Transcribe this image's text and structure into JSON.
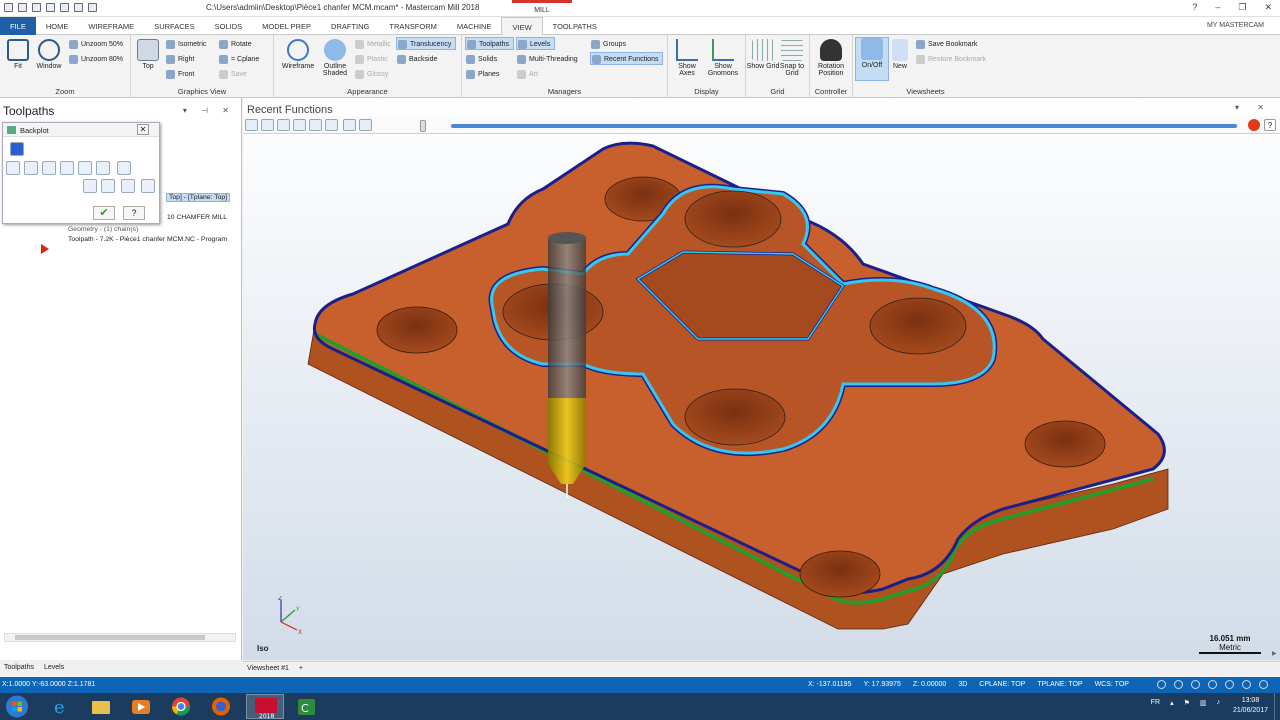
{
  "titlebar": {
    "path": "C:\\Users\\admiin\\Desktop\\Pièce1 chanfer MCM.mcam* - Mastercam Mill 2018",
    "context_tab": "MILL"
  },
  "tabs": [
    {
      "label": "FILE",
      "kind": "file"
    },
    {
      "label": "HOME",
      "kind": ""
    },
    {
      "label": "WIREFRAME",
      "kind": ""
    },
    {
      "label": "SURFACES",
      "kind": ""
    },
    {
      "label": "SOLIDS",
      "kind": ""
    },
    {
      "label": "MODEL PREP",
      "kind": ""
    },
    {
      "label": "DRAFTING",
      "kind": ""
    },
    {
      "label": "TRANSFORM",
      "kind": ""
    },
    {
      "label": "MACHINE",
      "kind": ""
    },
    {
      "label": "VIEW",
      "kind": "active"
    },
    {
      "label": "TOOLPATHS",
      "kind": "ctx"
    }
  ],
  "my_mastercam": "MY MASTERCAM",
  "ribbon": {
    "zoom": {
      "label": "Zoom",
      "fit": "Fit",
      "window": "Window",
      "unzoom50": "Unzoom 50%",
      "unzoom80": "Unzoom 80%"
    },
    "graphics_view": {
      "label": "Graphics View",
      "top": "Top",
      "isometric": "Isometric",
      "right": "Right",
      "front": "Front",
      "rotate": "Rotate",
      "cplane": "= Cplane",
      "save": "Save"
    },
    "appearance": {
      "label": "Appearance",
      "wireframe": "Wireframe",
      "outline_shaded": "Outline Shaded",
      "metallic": "Metallic",
      "plastic": "Plastic",
      "glossy": "Glossy",
      "translucency": "Translucency",
      "backside": "Backside"
    },
    "managers": {
      "label": "Managers",
      "toolpaths": "Toolpaths",
      "solids": "Solids",
      "planes": "Planes",
      "levels": "Levels",
      "multithreading": "Multi-Threading",
      "art": "Art",
      "groups": "Groups",
      "recent": "Recent Functions"
    },
    "display": {
      "label": "Display",
      "show_axes": "Show Axes",
      "show_gnomons": "Show Gnomons"
    },
    "grid": {
      "label": "Grid",
      "show_grid": "Show Grid",
      "snap_grid": "Snap to Grid"
    },
    "controller": {
      "label": "Controller",
      "rotation": "Rotation Position"
    },
    "viewsheets": {
      "label": "Viewsheets",
      "onoff": "On/Off",
      "new": "New",
      "save_bookmark": "Save Bookmark",
      "restore_bookmark": "Restore Bookmark"
    }
  },
  "left_panel": {
    "title": "Toolpaths",
    "backplot": {
      "title": "Backplot"
    },
    "tree": {
      "selected": "Top] - [Tplane: Top]",
      "op": "10 CHAMFER MILL",
      "geometry": "Geometry - (1) chain(s)",
      "toolpath": "Toolpath - 7.2K - Pièce1 chanfer MCM.NC - Program"
    },
    "tabs": [
      "Toolpaths",
      "Levels"
    ]
  },
  "viewport": {
    "title": "Recent Functions",
    "view_name": "Iso",
    "scale": {
      "value": "16.051 mm",
      "unit": "Metric"
    },
    "viewsheet_tab": "Viewsheet #1",
    "viewsheet_add": "+"
  },
  "statusbar": {
    "left": "X:1.0000   Y:-63.0000   Z:1.1781",
    "x": "X:  -137.01195",
    "y": "Y:  17.93975",
    "z": "Z:  0.00000",
    "mode": "3D",
    "cplane": "CPLANE: TOP",
    "tplane": "TPLANE: TOP",
    "wcs": "WCS: TOP"
  },
  "taskbar": {
    "lang": "FR",
    "time": "13:08",
    "date": "21/06/2017",
    "mastercam_badge": "2018"
  },
  "colors": {
    "accent": "#1f5fa8",
    "part": "#c8602e",
    "toolpath_outer": "#1a1f8a",
    "toolpath_inner": "#36c8f0",
    "chamfer": "#2a9a2a",
    "status": "#0f65b5"
  }
}
